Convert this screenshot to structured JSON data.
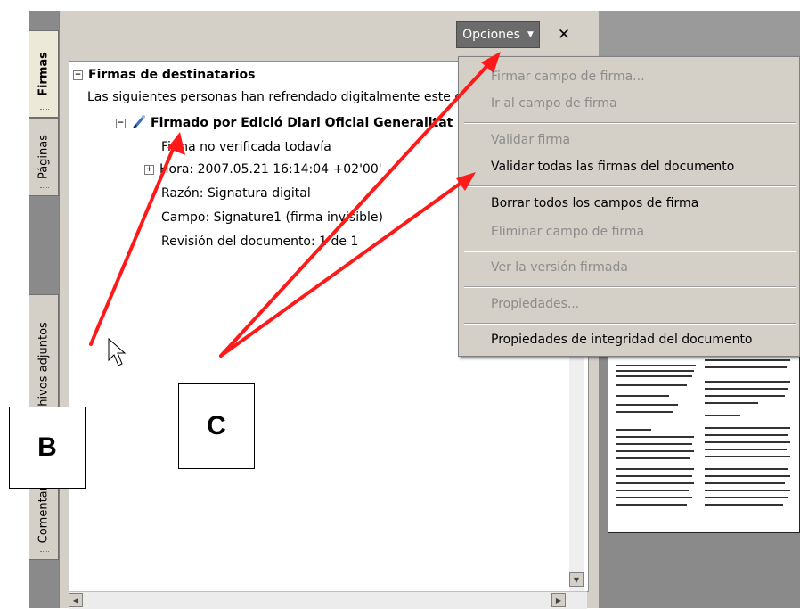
{
  "tabs": [
    {
      "label": "Firmas",
      "active": true
    },
    {
      "label": "Páginas",
      "active": false
    },
    {
      "label": "Archivos adjuntos",
      "active": false
    },
    {
      "label": "Comentarios",
      "active": false
    }
  ],
  "panel": {
    "options_label": "Opciones",
    "close_label": "✕"
  },
  "tree": {
    "root_label": "Firmas de destinatarios",
    "intro_text": "Las siguientes personas han refrendado digitalmente este d",
    "signature_label": "Firmado por Edició Diari Oficial Generalitat",
    "status_text": "Firma no verificada todavía",
    "time_text": "Hora: 2007.05.21 16:14:04 +02'00'",
    "reason_text": "Razón: Signatura digital",
    "field_text": "Campo: Signature1 (firma invisible)",
    "revision_text": "Revisión del documento: 1 de 1"
  },
  "menu": {
    "items": [
      {
        "label": "Firmar campo de firma...",
        "enabled": false
      },
      {
        "label": "Ir al campo de firma",
        "enabled": false
      },
      {
        "label": "Validar firma",
        "enabled": false
      },
      {
        "label": "Validar todas las firmas del documento",
        "enabled": true
      },
      {
        "label": "Borrar todos los campos de firma",
        "enabled": true
      },
      {
        "label": "Eliminar campo de firma",
        "enabled": false
      },
      {
        "label": "Ver la versión firmada",
        "enabled": false
      },
      {
        "label": "Propiedades...",
        "enabled": false
      },
      {
        "label": "Propiedades de integridad del documento",
        "enabled": true
      }
    ]
  },
  "callouts": {
    "b": "B",
    "c": "C"
  },
  "colors": {
    "arrow": "#ff1a1a",
    "menu_bg": "#d4d0c8",
    "options_button": "#6b6b6b"
  }
}
